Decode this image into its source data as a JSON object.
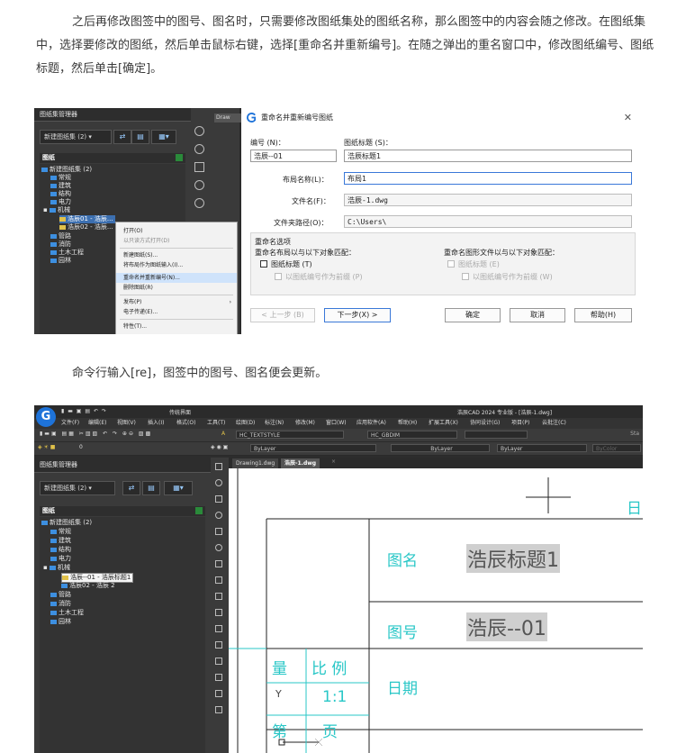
{
  "article": {
    "para1": "之后再修改图签中的图号、图名时，只需要修改图纸集处的图纸名称，那么图签中的内容会随之修改。在图纸集中，选择要修改的图纸，然后单击鼠标右键，选择[重命名并重新编号]。在随之弹出的重名窗口中，修改图纸编号、图纸标题，然后单击[确定]。",
    "para2": "命令行输入[re]，图签中的图号、图名便会更新。"
  },
  "sheet_manager": {
    "title": "图纸集管理器",
    "new_set_dropdown": "新建图纸集 (2)",
    "tree_header": "图纸",
    "root": "新建图纸集 (2)",
    "folders": [
      "常规",
      "建筑",
      "结构",
      "电力",
      "机械"
    ],
    "sheet_01_before": "浩辰01 - 浩辰...",
    "sheet_02_before": "浩辰02 - 浩辰...",
    "folders_after": [
      "管路",
      "消防",
      "土木工程",
      "园林"
    ],
    "sheet_01_after": "浩辰--01 - 浩辰标题1",
    "sheet_02_after": "浩辰02 - 浩辰 2",
    "drawing_tab": "Draw"
  },
  "context_menu": {
    "items": [
      {
        "label": "打开(O)",
        "style": "normal"
      },
      {
        "label": "以只读方式打开(D)",
        "style": "gray"
      },
      {
        "label": "新建图纸(S)...",
        "style": "normal"
      },
      {
        "label": "将布局作为图纸输入(I)...",
        "style": "normal"
      },
      {
        "label": "重命名并重新编号(N)...",
        "style": "highlight"
      },
      {
        "label": "删除图纸(R)",
        "style": "normal"
      },
      {
        "label": "发布(P)",
        "style": "normal",
        "arrow": "›"
      },
      {
        "label": "电子传递(E)...",
        "style": "normal"
      },
      {
        "label": "特性(T)...",
        "style": "normal"
      }
    ]
  },
  "rename_dialog": {
    "title": "重命名并重新编号图纸",
    "close": "✕",
    "number_label": "编号 (N)：",
    "number_value": "浩辰--01",
    "sheet_title_label": "图纸标题 (S)：",
    "sheet_title_value": "浩辰标题1",
    "layout_label": "布局名称(L)：",
    "layout_value": "布局1",
    "file_label": "文件名(F)：",
    "file_value": "浩辰-1.dwg",
    "folder_label": "文件夹路径(O)：",
    "folder_value": "C:\\Users\\",
    "options_title": "重命名选项",
    "layout_match_label": "重命名布局以与以下对象匹配：",
    "layout_match_cb1": "图纸标题 (T)",
    "layout_match_cb2": "以图纸编号作为前缀 (P)",
    "file_match_label": "重命名图形文件以与以下对象匹配：",
    "file_match_cb1": "图纸标题 (E)",
    "file_match_cb2": "以图纸编号作为前缀 (W)",
    "btn_prev": "< 上一步 (B)",
    "btn_next": "下一步(X) >",
    "btn_ok": "确定",
    "btn_cancel": "取消",
    "btn_help": "帮助(H)"
  },
  "cad_window": {
    "title": "浩辰CAD 2024 专业版 - [浩辰-1.dwg]",
    "theme_label": "传统界面",
    "menus": [
      "文件(F)",
      "编辑(E)",
      "视图(V)",
      "插入(I)",
      "格式(O)",
      "工具(T)",
      "绘图(D)",
      "标注(N)",
      "修改(M)",
      "窗口(W)",
      "应用软件(A)",
      "帮助(H)",
      "扩展工具(X)",
      "协同设计(G)",
      "项目(P)",
      "云批注(C)"
    ],
    "text_style": "HC_TEXTSTYLE",
    "dim_style": "HC_GBDIM",
    "layer_color": "ByLayer",
    "linetype": "ByLayer",
    "lineweight": "ByLayer",
    "plotstyle": "ByColor",
    "layer_name": "0",
    "tab_drawing1": "Drawing1.dwg",
    "tab_current": "浩辰-1.dwg",
    "toolbar_end": "Sta"
  },
  "title_block": {
    "label_name": "图名",
    "value_name": "浩辰标题1",
    "label_number": "图号",
    "value_number": "浩辰--01",
    "label_date": "日期",
    "label_qty": "量",
    "label_scale": "比 例",
    "value_scale": "1:1",
    "label_sheet": "第",
    "label_page": "页",
    "edge_char": "日"
  },
  "colors": {
    "cad_dark": "#3a3a3a",
    "selection": "#3c6fb0",
    "accent_blue": "#1e73d9",
    "drawing_cyan": "#29c7c7"
  }
}
